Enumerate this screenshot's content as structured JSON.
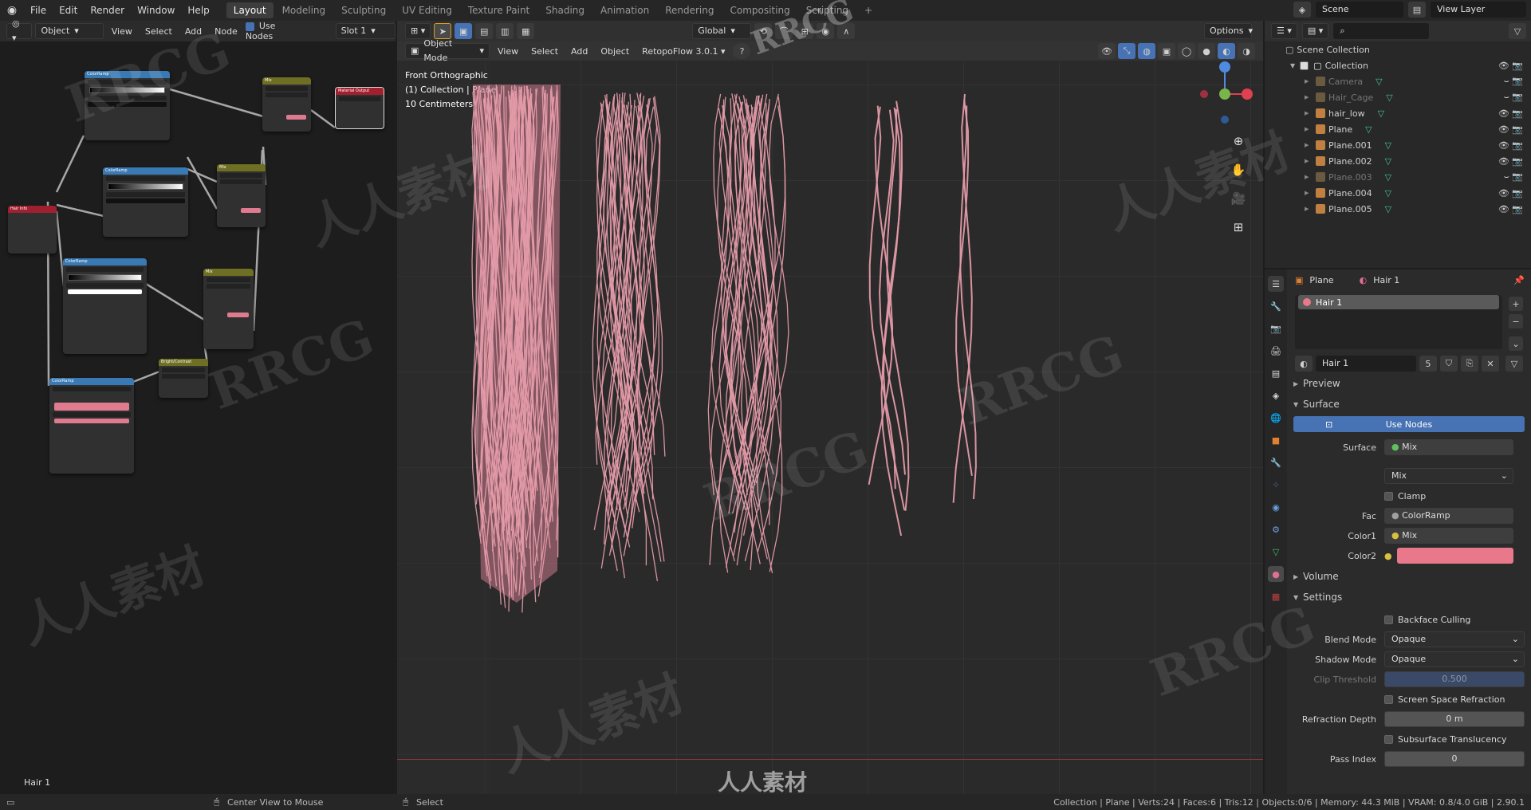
{
  "topbar": {
    "menus": [
      "File",
      "Edit",
      "Render",
      "Window",
      "Help"
    ],
    "workspaces": [
      "Layout",
      "Modeling",
      "Sculpting",
      "UV Editing",
      "Texture Paint",
      "Shading",
      "Animation",
      "Rendering",
      "Compositing",
      "Scripting"
    ],
    "add_tab": "+",
    "scene": "Scene",
    "view_layer": "View Layer"
  },
  "node_editor": {
    "editor_type": "Object",
    "menus": [
      "View",
      "Select",
      "Add",
      "Node"
    ],
    "use_nodes_label": "Use Nodes",
    "slot": "Slot 1",
    "material_label": "Hair 1",
    "nodes": [
      {
        "title": "ColorRamp",
        "color": "#3a7ab4"
      },
      {
        "title": "Mix",
        "color": "#6f6f24"
      },
      {
        "title": "Material Output",
        "color": "#a02030"
      },
      {
        "title": "ColorRamp",
        "color": "#3a7ab4"
      },
      {
        "title": "Mix",
        "color": "#6f6f24"
      },
      {
        "title": "Hair Info",
        "color": "#a02030"
      },
      {
        "title": "ColorRamp",
        "color": "#3a7ab4"
      },
      {
        "title": "Mix",
        "color": "#6f6f24"
      },
      {
        "title": "Bright/Contrast",
        "color": "#6f6f24"
      },
      {
        "title": "ColorRamp",
        "color": "#3a7ab4"
      }
    ]
  },
  "viewport": {
    "mode": "Object Mode",
    "menus": [
      "View",
      "Select",
      "Add",
      "Object"
    ],
    "addon": "RetopoFlow 3.0.1",
    "transform_space": "Global",
    "options_label": "Options",
    "info_lines": [
      "Front Orthographic",
      "(1) Collection | Plane",
      "10 Centimeters"
    ],
    "hair_color": "#e39aa8"
  },
  "outliner": {
    "root": "Scene Collection",
    "collection": "Collection",
    "items": [
      {
        "name": "Camera",
        "dim": true
      },
      {
        "name": "Hair_Cage",
        "dim": true
      },
      {
        "name": "hair_low",
        "dim": false
      },
      {
        "name": "Plane",
        "dim": false
      },
      {
        "name": "Plane.001",
        "dim": false
      },
      {
        "name": "Plane.002",
        "dim": false
      },
      {
        "name": "Plane.003",
        "dim": true
      },
      {
        "name": "Plane.004",
        "dim": false
      },
      {
        "name": "Plane.005",
        "dim": false
      }
    ]
  },
  "properties": {
    "object": "Plane",
    "material": "Hair 1",
    "slot_name": "Hair 1",
    "material_field": "Hair 1",
    "user_count": "5",
    "sections": {
      "preview": "Preview",
      "surface": "Surface",
      "volume": "Volume",
      "settings": "Settings"
    },
    "use_nodes": "Use Nodes",
    "surface_label": "Surface",
    "surface_value": "Mix",
    "mix_mode": "Mix",
    "clamp": "Clamp",
    "fac_label": "Fac",
    "fac_value": "ColorRamp",
    "color1_label": "Color1",
    "color1_value": "Mix",
    "color2_label": "Color2",
    "color2_swatch": "#e8788a",
    "backface": "Backface Culling",
    "blend_label": "Blend Mode",
    "blend_value": "Opaque",
    "shadow_label": "Shadow Mode",
    "shadow_value": "Opaque",
    "clip_label": "Clip Threshold",
    "clip_value": "0.500",
    "ssr": "Screen Space Refraction",
    "refr_label": "Refraction Depth",
    "refr_value": "0 m",
    "sst": "Subsurface Translucency",
    "pass_label": "Pass Index",
    "pass_value": "0"
  },
  "status": {
    "hint1": "Center View to Mouse",
    "hint2": "Select",
    "stats": "Collection | Plane | Verts:24 | Faces:6 | Tris:12 | Objects:0/6 | Memory: 44.3 MiB | VRAM: 0.8/4.0 GiB | 2.90.1"
  },
  "watermarks": {
    "rrcg": "RRCG",
    "cn": "人人素材"
  }
}
